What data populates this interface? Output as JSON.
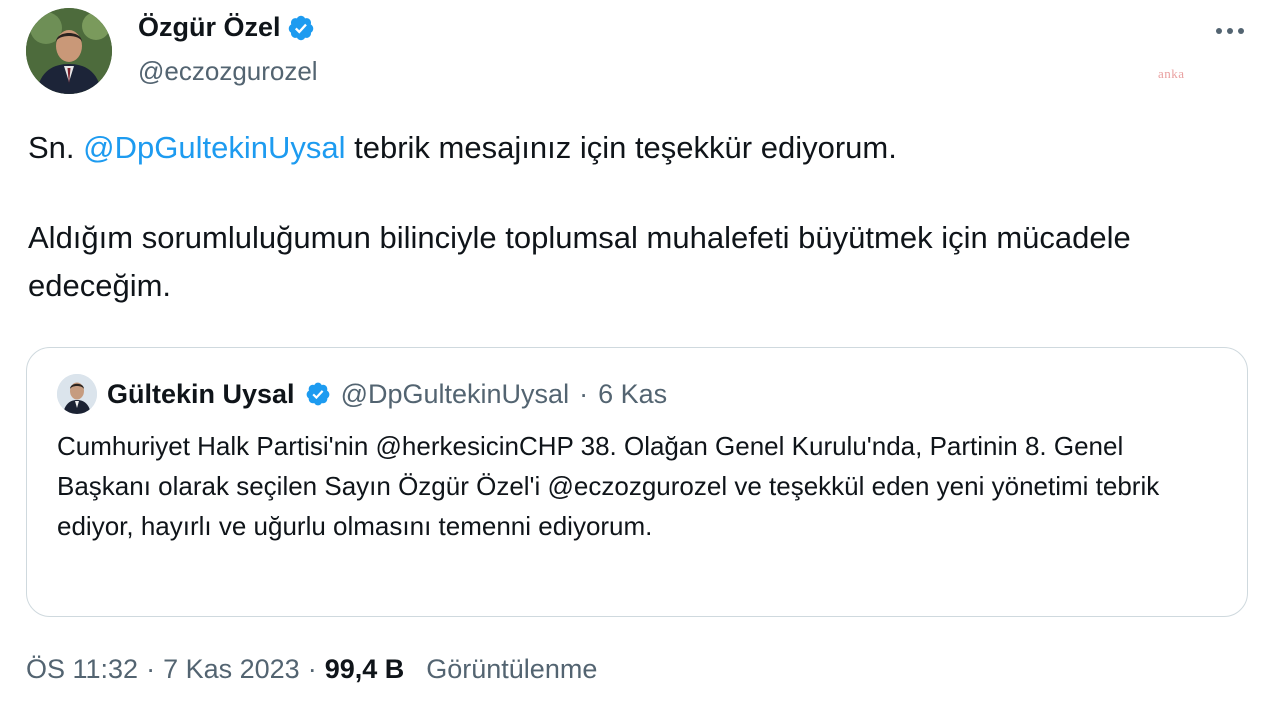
{
  "author": {
    "name": "Özgür Özel",
    "handle": "@eczozgurozel"
  },
  "more_icon": "more-horizontal-icon",
  "watermark": "anka",
  "tweet": {
    "prefix": "Sn.",
    "mention": "@DpGultekinUysal",
    "line1_rest": "tebrik mesajınız için teşekkür ediyorum.",
    "paragraph2": "Aldığım sorumluluğumun bilinciyle toplumsal muhalefeti büyütmek için mücadele edeceğim."
  },
  "quoted": {
    "name": "Gültekin Uysal",
    "handle": "@DpGultekinUysal",
    "separator": "·",
    "date": "6 Kas",
    "text": "Cumhuriyet Halk Partisi'nin @herkesicinCHP 38. Olağan Genel Kurulu'nda, Partinin 8. Genel Başkanı olarak seçilen Sayın Özgür Özel'i @eczozgurozel ve teşekkül eden yeni yönetimi tebrik ediyor, hayırlı ve uğurlu olmasını temenni ediyorum."
  },
  "meta": {
    "time": "ÖS 11:32",
    "separator": "·",
    "date": "7 Kas 2023",
    "views_count": "99,4 B",
    "views_label": "Görüntülenme"
  },
  "colors": {
    "verified": "#1d9bf0",
    "mention": "#1d9bf0",
    "secondary_text": "#536471",
    "border": "#cfd9de"
  }
}
